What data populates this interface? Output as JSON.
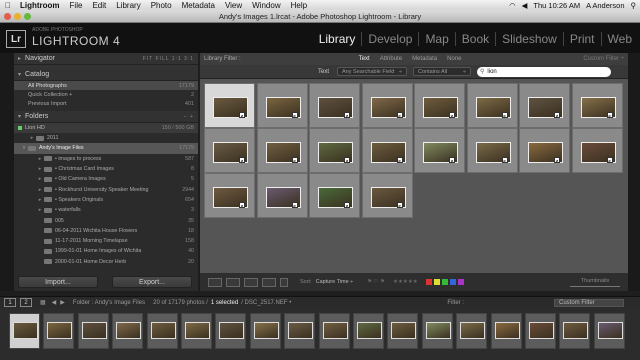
{
  "menubar": {
    "apple": "",
    "items": [
      "Lightroom",
      "File",
      "Edit",
      "Library",
      "Photo",
      "Metadata",
      "View",
      "Window",
      "Help"
    ],
    "clock": "Thu 10:26 AM",
    "user": "A Anderson"
  },
  "window": {
    "title": "Andy's Images 1.lrcat - Adobe Photoshop Lightroom - Library"
  },
  "identity": {
    "logo": "Lr",
    "small": "ADOBE PHOTOSHOP",
    "name": "LIGHTROOM 4"
  },
  "modules": [
    "Library",
    "Develop",
    "Map",
    "Book",
    "Slideshow",
    "Print",
    "Web"
  ],
  "navigator": {
    "label": "Navigator",
    "options": "FIT  FILL  1:1  3:1"
  },
  "catalog": {
    "label": "Catalog",
    "rows": [
      {
        "label": "All Photographs",
        "count": "17179"
      },
      {
        "label": "Quick Collection  +",
        "count": "2"
      },
      {
        "label": "Previous Import",
        "count": "401"
      }
    ]
  },
  "folders": {
    "label": "Folders",
    "plus": "−  +",
    "volume": "Lion HD",
    "volume_usage": "150 / 500 GB",
    "rows": [
      {
        "label": "2011",
        "count": "",
        "indent": 1,
        "tri": "▸"
      },
      {
        "label": "Andy's Image Files",
        "count": "17179",
        "indent": 0,
        "tri": "▾",
        "sel": true
      },
      {
        "label": "• images to process",
        "count": "587",
        "indent": 2,
        "tri": "▸"
      },
      {
        "label": "• Christmas Card Images",
        "count": "8",
        "indent": 2,
        "tri": "▸"
      },
      {
        "label": "• Old Camera Images",
        "count": "5",
        "indent": 2,
        "tri": "▸"
      },
      {
        "label": "• Rockhurst University Speaker Meeting",
        "count": "2944",
        "indent": 2,
        "tri": "▸"
      },
      {
        "label": "• Speakers Originals",
        "count": "654",
        "indent": 2,
        "tri": "▸"
      },
      {
        "label": "• waterfalls",
        "count": "3",
        "indent": 2,
        "tri": "▸"
      },
      {
        "label": "005",
        "count": "35",
        "indent": 2,
        "tri": ""
      },
      {
        "label": "06-04-2011 Wichita House Flowers",
        "count": "18",
        "indent": 2,
        "tri": ""
      },
      {
        "label": "11-17-2011 Morning Timelapse",
        "count": "158",
        "indent": 2,
        "tri": ""
      },
      {
        "label": "1999-01-01 Home Images of Wichita",
        "count": "40",
        "indent": 2,
        "tri": ""
      },
      {
        "label": "2000-01-01 Home Decor Herb",
        "count": "20",
        "indent": 2,
        "tri": ""
      }
    ]
  },
  "buttons": {
    "import": "Import...",
    "export": "Export..."
  },
  "filter": {
    "label": "Library Filter :",
    "tabs": [
      "Text",
      "Attribute",
      "Metadata",
      "None"
    ],
    "preset": "Custom Filter ÷",
    "text_label": "Text",
    "field": "Any Searchable Field",
    "rule": "Contains All",
    "query": "lion"
  },
  "grid": {
    "thumb_colors": [
      "#6a5a40",
      "#7a6540",
      "#5e5040",
      "#80684a",
      "#6e5c3e",
      "#7d6a45",
      "#5f5240",
      "#85704a",
      "#6a5c46",
      "#725f42",
      "#5e6a42",
      "#6d5d3f",
      "#808a60",
      "#7a6a48",
      "#8a6a40",
      "#6a4c3a",
      "#6f5a40",
      "#6a5a70",
      "#4a6a3a",
      "#6b5940"
    ],
    "selected_index": 0
  },
  "toolbar": {
    "sort_label": "Sort:",
    "sort_value": "Capture Time ÷",
    "thumbnails": "Thumbnails",
    "label_colors": [
      "#d33",
      "#dd3",
      "#3b3",
      "#36d",
      "#a3c"
    ]
  },
  "filmstrip": {
    "pages": [
      "1",
      "2"
    ],
    "path": "Folder : Andy's Image Files",
    "count_text": "20 of 17179 photos /",
    "selected_text": "1 selected",
    "file": "/ DSC_2517.NEF •",
    "filter_label": "Filter :",
    "filter_value": "Custom Filter"
  }
}
